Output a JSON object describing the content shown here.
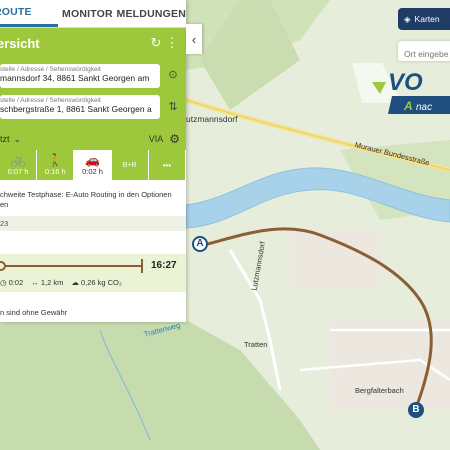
{
  "tabs": [
    "ROUTE",
    "MONITOR",
    "MELDUNGEN"
  ],
  "header": {
    "title": "ersicht"
  },
  "start": {
    "hint": "stelle / Adresse / Sehenswürdigkeit",
    "value": "mannsdorf 34, 8861 Sankt Georgen am"
  },
  "end": {
    "hint": "stelle / Adresse / Sehenswürdigkeit",
    "value": "schbergstraße 1, 8861 Sankt Georgen a"
  },
  "options": {
    "when": "tzt",
    "via": "VIA"
  },
  "modes": [
    {
      "icon": "bike-icon",
      "glyph": "🚲",
      "time": "0:07 h"
    },
    {
      "icon": "walk-icon",
      "glyph": "🚶",
      "time": "0:16 h"
    },
    {
      "icon": "car-icon",
      "glyph": "🚗",
      "time": "0:02 h"
    },
    {
      "icon": "bike-and-ride-icon",
      "glyph": "B+R",
      "time": ""
    },
    {
      "icon": "more-icon",
      "glyph": "•••",
      "time": ""
    }
  ],
  "notice": "chweite Testphase: E-Auto Routing in den Optionen en",
  "route_id": "23",
  "route": {
    "arrival": "16:27",
    "duration": "0:02",
    "distance": "1,2 km",
    "co2": "0,26 kg CO₂"
  },
  "footer_note": "n sind ohne Gewähr",
  "map": {
    "kartenbutton": "Karten",
    "ort_placeholder": "Ort eingebe",
    "labels": {
      "lutzmannsdorf_top": "utzmannsdorf",
      "bundesstrasse": "Murauer Bundesstraße",
      "lutzmannsdorf_road": "Lutzmannsdorf",
      "trattenweg": "Trattenweg",
      "tratten": "Tratten",
      "bergfalterbach": "Bergfalterbach"
    },
    "marker_a": "A",
    "marker_b": "B"
  },
  "colors": {
    "accent": "#9dc83b",
    "brand": "#1e3c66",
    "route": "#8b5e34",
    "river": "#a8d2ea"
  }
}
